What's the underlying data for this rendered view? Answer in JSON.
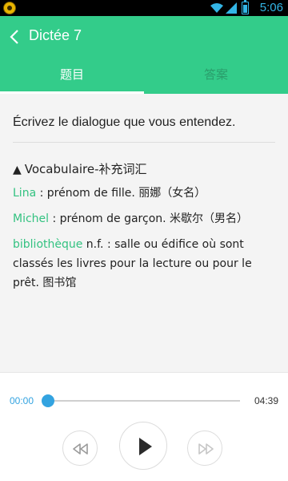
{
  "status_bar": {
    "time": "5:06",
    "battery_level": 0.8,
    "accent_color": "#33b5e5"
  },
  "app_bar": {
    "title": "Dictée 7",
    "back_icon": "chevron-left-icon",
    "color": "#33cc8a"
  },
  "tabs": [
    {
      "label": "题目",
      "selected": true
    },
    {
      "label": "答案",
      "selected": false
    }
  ],
  "content": {
    "prompt": "Écrivez le dialogue que vous entendez.",
    "vocab_heading": "Vocabulaire-补充词汇",
    "vocab_marker": "▲",
    "vocab": [
      {
        "term": "Lina",
        "definition": " : prénom de fille. 丽娜（女名）"
      },
      {
        "term": "Michel",
        "definition": " : prénom de garçon. 米歇尔（男名）"
      },
      {
        "term": "bibliothèque",
        "definition": " n.f. : salle ou édifice où sont classés les livres pour la lecture ou pour le prêt. 图书馆"
      }
    ],
    "term_color": "#33c281"
  },
  "player": {
    "elapsed": "00:00",
    "total": "04:39",
    "progress": 0.0,
    "controls": [
      "rewind-icon",
      "play-icon",
      "fast-forward-icon"
    ],
    "accent_color": "#33a3e0"
  }
}
